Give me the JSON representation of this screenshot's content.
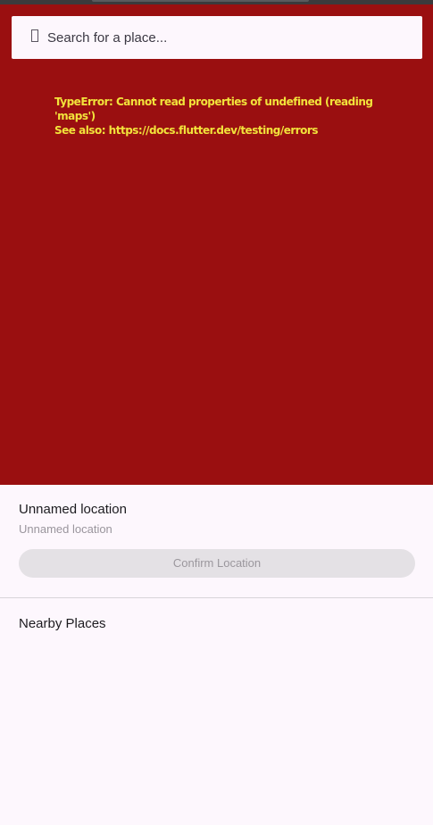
{
  "search": {
    "icon": "search-icon",
    "placeholder": "Search for a place..."
  },
  "error": {
    "line1": "TypeError: Cannot read properties of undefined (reading 'maps')",
    "line2": "See also: https://docs.flutter.dev/testing/errors"
  },
  "location": {
    "name": "Unnamed location",
    "address": "Unnamed location"
  },
  "actions": {
    "confirm_label": "Confirm Location"
  },
  "nearby": {
    "title": "Nearby Places",
    "items": []
  },
  "colors": {
    "map_error_background": "#9a0f10",
    "error_text": "#f2e33b",
    "sheet_background": "#fdf7fd",
    "disabled_button": "#e4e1e5"
  }
}
